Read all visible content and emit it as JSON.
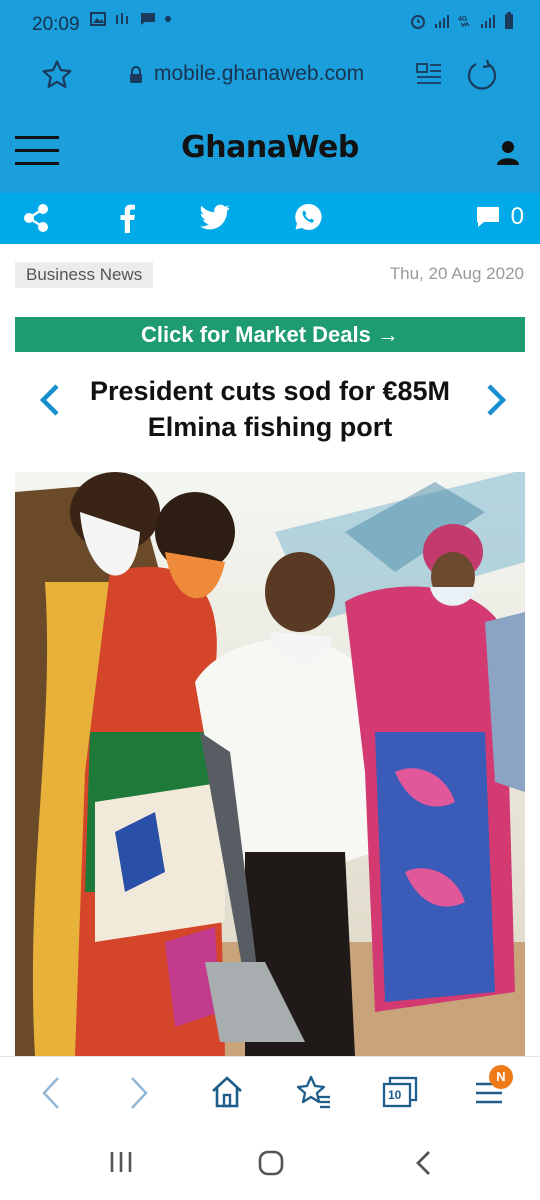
{
  "status": {
    "time": "20:09"
  },
  "browser": {
    "url": "mobile.ghanaweb.com"
  },
  "brand": {
    "logo": "GhanaWeb"
  },
  "share": {
    "comment_count": "0"
  },
  "article": {
    "category": "Business News",
    "date": "Thu, 20 Aug 2020",
    "promo": "Click for Market Deals →",
    "headline": "President cuts sod for €85M Elmina fishing port"
  },
  "bottom_nav": {
    "tabs_count": "10",
    "menu_badge": "N"
  },
  "colors": {
    "top_bar": "#1a9fdc",
    "share_bar": "#00a9e8",
    "promo": "#1f9b73",
    "nav_arrow": "#1a8fd0",
    "badge": "#f07a1a"
  }
}
